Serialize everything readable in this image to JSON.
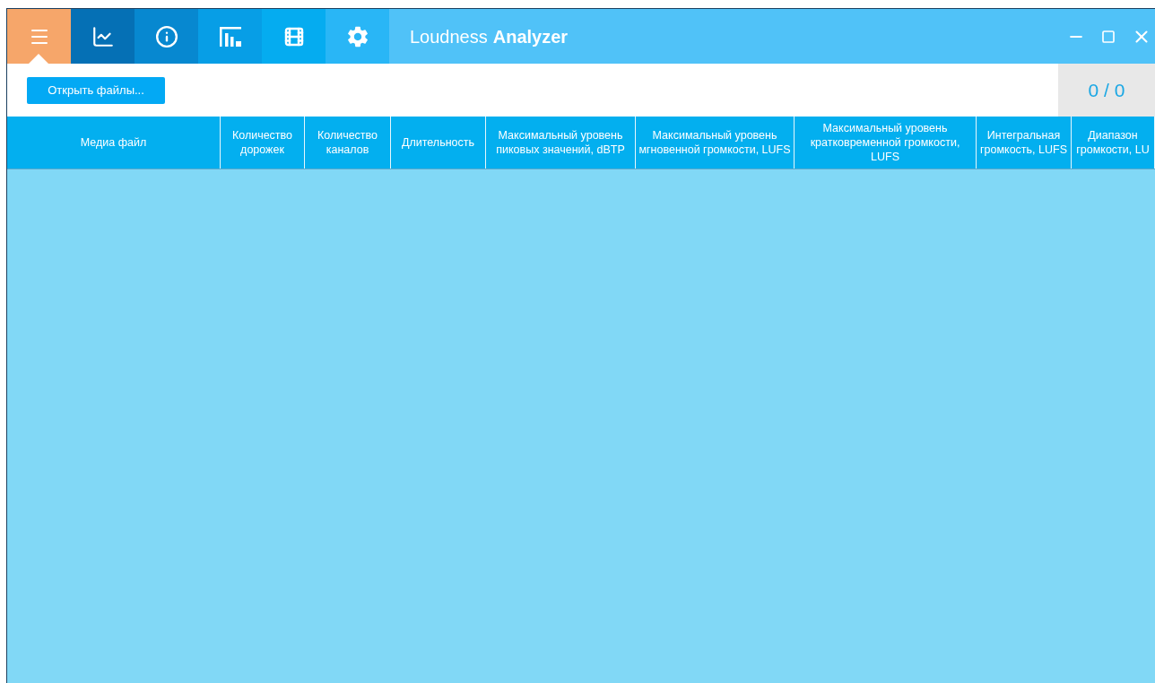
{
  "tabs": [
    {
      "kind": "menu",
      "selected": true
    },
    {
      "kind": "chart",
      "selected": false
    },
    {
      "kind": "info",
      "selected": false
    },
    {
      "kind": "bars",
      "selected": false
    },
    {
      "kind": "film",
      "selected": false
    },
    {
      "kind": "settings",
      "selected": false
    }
  ],
  "app_title": {
    "light": "Loudness",
    "bold": "Analyzer"
  },
  "toolbar": {
    "open_button": "Открыть файлы...",
    "counter": "0 / 0"
  },
  "table": {
    "columns": [
      "Медиа файл",
      "Количество дорожек",
      "Количество каналов",
      "Длительность",
      "Максимальный уровень пиковых значений, dBTP",
      "Максимальный уровень мгновенной громкости, LUFS",
      "Максимальный уровень кратковременной громкости, LUFS",
      "Интегральная громкость, LUFS",
      "Диапазон громкости, LU"
    ]
  }
}
